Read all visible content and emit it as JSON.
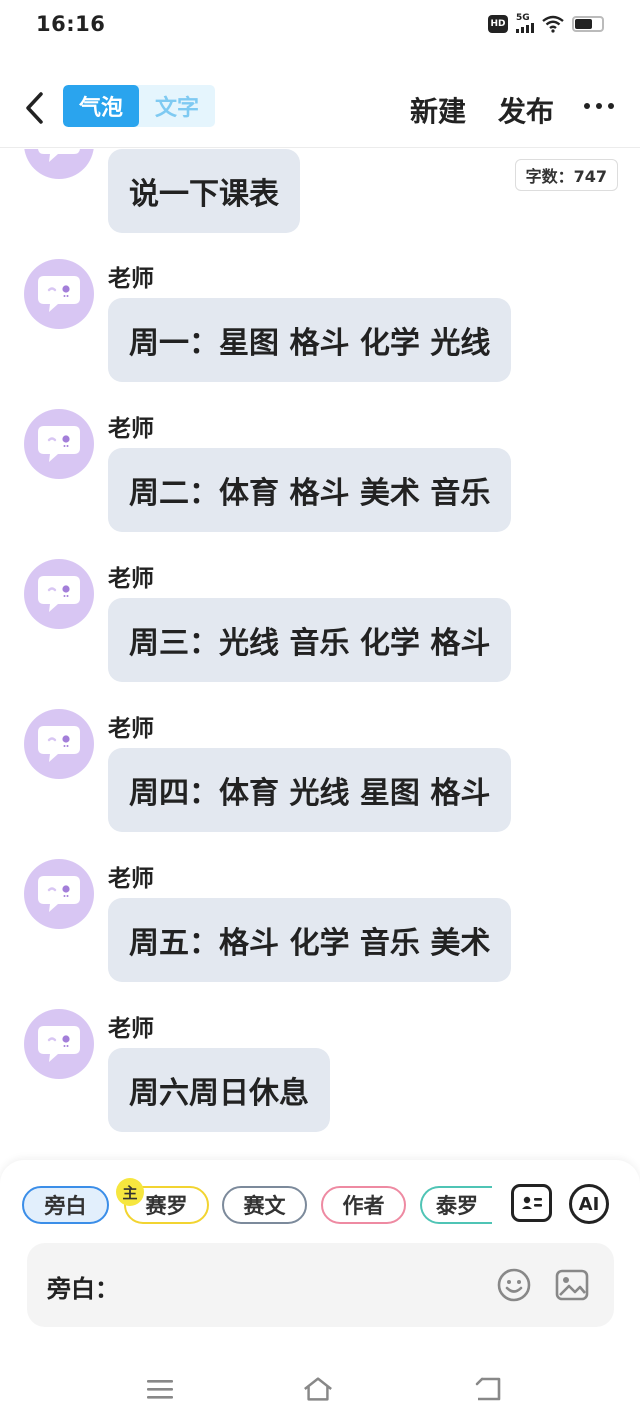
{
  "status_bar": {
    "time": "16:16",
    "hd_label": "HD",
    "network_label": "5G",
    "icons": [
      "hd-icon",
      "signal-icon",
      "wifi-icon",
      "battery-icon"
    ]
  },
  "nav": {
    "mode_bubble": "气泡",
    "mode_text": "文字",
    "new_label": "新建",
    "publish_label": "发布",
    "more_icon": "more-dots-icon",
    "back_icon": "chevron-left-icon"
  },
  "word_count": "字数：747",
  "messages": [
    {
      "name": "",
      "text": "说一下课表"
    },
    {
      "name": "老师",
      "text": "周一：星图 格斗 化学 光线"
    },
    {
      "name": "老师",
      "text": "周二：体育 格斗 美术 音乐"
    },
    {
      "name": "老师",
      "text": "周三：光线 音乐 化学 格斗"
    },
    {
      "name": "老师",
      "text": "周四：体育 光线 星图 格斗"
    },
    {
      "name": "老师",
      "text": "周五：格斗 化学 音乐 美术"
    },
    {
      "name": "老师",
      "text": "周六周日休息"
    }
  ],
  "composer": {
    "roles": [
      "旁白",
      "赛罗",
      "赛文",
      "作者",
      "泰罗"
    ],
    "main_badge": "主",
    "ai_label": "AI",
    "input_prefix": "旁白：",
    "input_value": ""
  },
  "colors": {
    "accent": "#2aa4ee",
    "bubble_bg": "#e3e8f0",
    "avatar_bg": "#d8c6f3"
  }
}
